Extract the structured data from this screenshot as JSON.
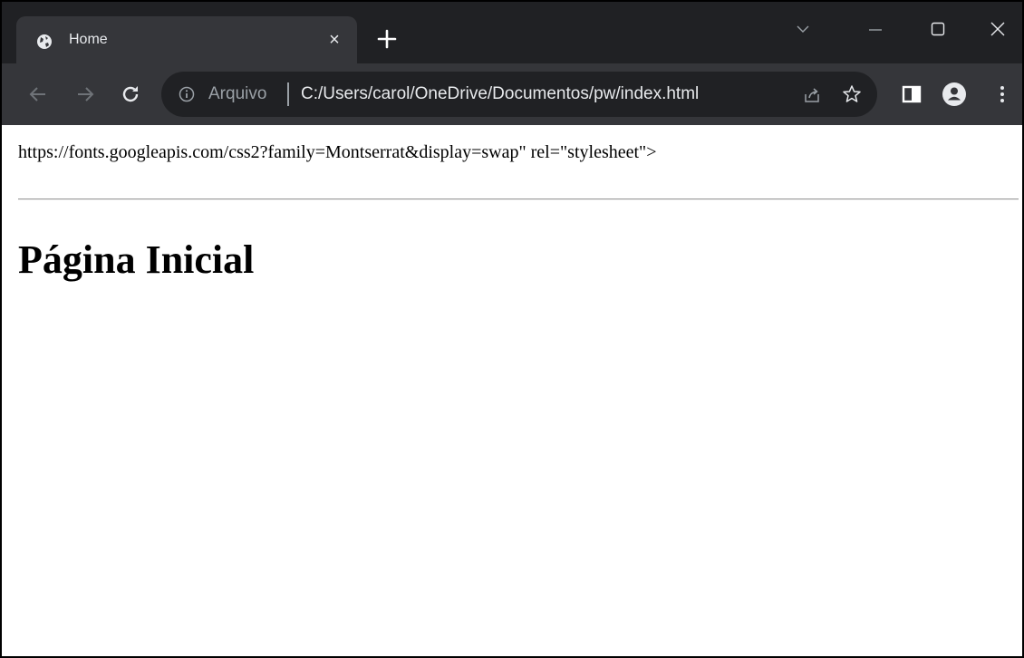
{
  "browser": {
    "tab": {
      "title": "Home",
      "favicon": "globe-icon",
      "close_glyph": "×"
    },
    "new_tab_icon": "plus-icon",
    "window_controls": [
      "chevron-down-icon",
      "minimize-icon",
      "maximize-icon",
      "close-icon"
    ],
    "toolbar": {
      "back_icon": "arrow-left-icon",
      "forward_icon": "arrow-right-icon",
      "reload_icon": "reload-icon",
      "omnibox": {
        "info_icon": "info-icon",
        "scheme_label": "Arquivo",
        "url": "C:/Users/carol/OneDrive/Documentos/pw/index.html",
        "share_icon": "share-icon",
        "bookmark_icon": "star-icon"
      },
      "side_panel_icon": "side-panel-icon",
      "profile_icon": "profile-icon",
      "menu_icon": "kebab-menu-icon"
    },
    "colors": {
      "tabstrip": "#202124",
      "toolbar": "#35363a",
      "text_light": "#e8eaed",
      "text_muted": "#9aa0a6"
    }
  },
  "page": {
    "stray_text": "https://fonts.googleapis.com/css2?family=Montserrat&display=swap\" rel=\"stylesheet\">",
    "heading": "Página Inicial"
  }
}
